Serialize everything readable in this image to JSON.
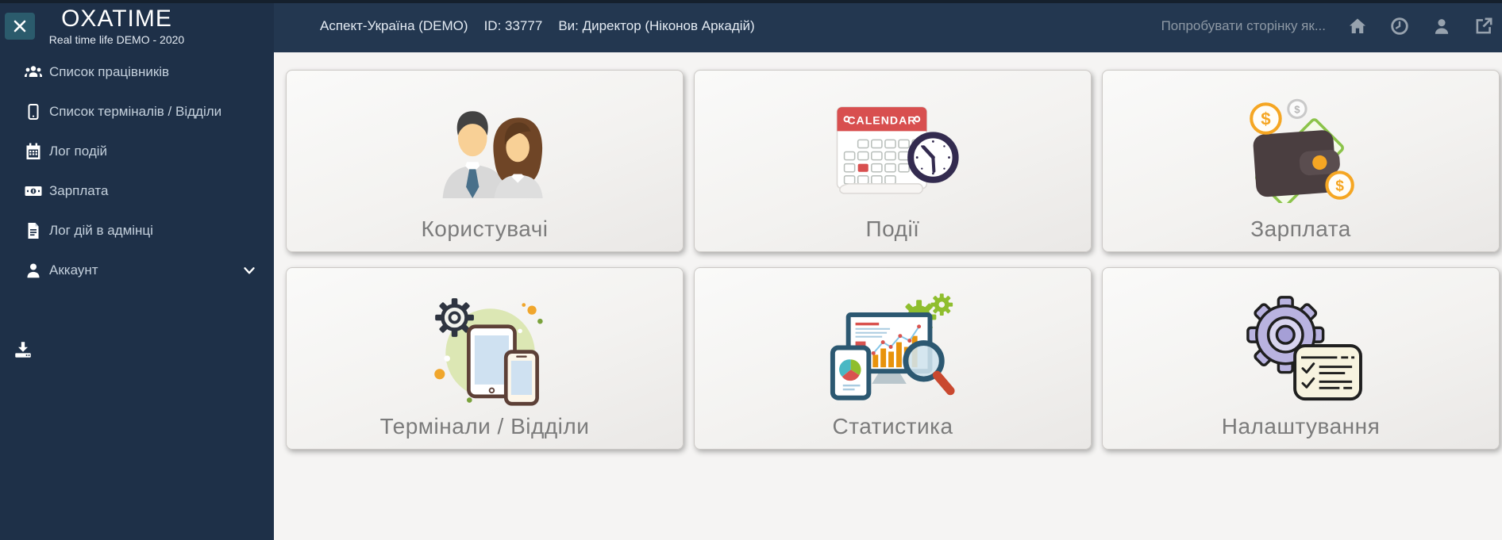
{
  "app": {
    "title": "OXATIME",
    "subtitle": "Real time life DEMO - 2020"
  },
  "header": {
    "company": "Аспект-Україна (DEMO)",
    "user_id": "ID: 33777",
    "current_user": "Ви: Директор (Ніконов Аркадій)",
    "try_page_as": "Попробувати сторінку як...",
    "icons": [
      "home-icon",
      "history-clock-icon",
      "user-icon",
      "open-external-icon"
    ]
  },
  "sidebar": {
    "toggle_icon": "close-icon",
    "items": [
      {
        "icon": "employees-group-icon",
        "label": "Список працівників"
      },
      {
        "icon": "terminal-tablet-icon",
        "label": "Список терміналів / Відділи"
      },
      {
        "icon": "calendar-icon",
        "label": "Лог подій"
      },
      {
        "icon": "money-bill-icon",
        "label": "Зарплата"
      },
      {
        "icon": "document-icon",
        "label": "Лог дій в адмінці"
      },
      {
        "icon": "account-user-icon",
        "label": "Аккаунт",
        "has_submenu": true
      }
    ],
    "footer_icon": "download-icon"
  },
  "tiles": [
    {
      "label": "Користувачі",
      "icon": "users-illustration"
    },
    {
      "label": "Події",
      "icon": "calendar-clock-illustration",
      "icon_text": "CALENDAR"
    },
    {
      "label": "Зарплата",
      "icon": "wallet-money-illustration",
      "currency_symbol": "$"
    },
    {
      "label": "Термінали / Відділи",
      "icon": "devices-illustration"
    },
    {
      "label": "Статистика",
      "icon": "statistics-illustration"
    },
    {
      "label": "Налаштування",
      "icon": "gear-checklist-illustration"
    }
  ],
  "colors": {
    "sidebar_bg": "#1e3048",
    "header_bg": "#233750",
    "toggle_button_teal": "#2b5b6c",
    "sidebar_text": "#c5d1dd",
    "header_text": "#e4ebf3",
    "muted_header_text": "#8d98a4",
    "main_bg": "#f5f4f3",
    "tile_label": "#7b7b7b",
    "calendar_red": "#d84f4f",
    "clock_indigo": "#332b4f",
    "coin_orange": "#f5a623",
    "banknote_green": "#8bc34a",
    "wallet_brown": "#4a3e40",
    "device_circle_green": "#dce7b4",
    "monitor_blue": "#2c5871",
    "bars_orange": "#e8930c",
    "magnifier_handle_red": "#c9482f",
    "gear_green": "#8fbe2e",
    "gear_lavender": "#b9b3e0",
    "tie_teal": "#49708a"
  }
}
